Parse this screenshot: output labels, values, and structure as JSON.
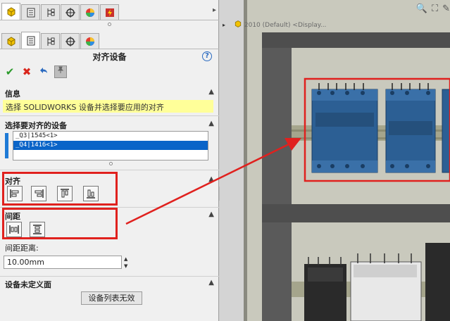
{
  "property_manager": {
    "title": "对齐设备",
    "help_label": "?",
    "info": {
      "heading": "信息",
      "message": "选择 SOLIDWORKS 设备并选择要应用的对齐"
    },
    "devices": {
      "heading": "选择要对齐的设备",
      "items": [
        "_Q3|1545<1>",
        "_Q4|1416<1>"
      ],
      "selected_index": 1
    },
    "align": {
      "heading": "对齐",
      "buttons": [
        "align-left-icon",
        "align-right-icon",
        "align-top-icon",
        "align-bottom-icon"
      ]
    },
    "spacing": {
      "heading": "间距",
      "buttons": [
        "spacing-horizontal-icon",
        "spacing-vertical-icon"
      ],
      "distance_label": "间距距离:",
      "distance_value": "10.00mm"
    },
    "undefined_section": {
      "heading": "设备未定义面",
      "button_label": "设备列表无效"
    }
  },
  "viewport": {
    "part_label": "2010 (Default) <Display...",
    "colors": {
      "frame_dark": "#555555",
      "device_blue": "#2c5f94",
      "highlight_red": "#e0211e",
      "background_panel": "#c9c9bd"
    }
  }
}
